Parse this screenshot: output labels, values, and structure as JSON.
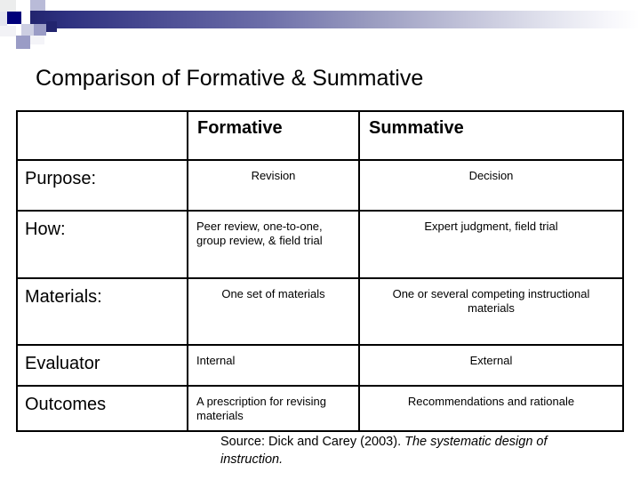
{
  "decoration": {
    "gradient_start_color": "#2e3180",
    "gradient_end_color": "#ffffff",
    "square_colors": {
      "dark": "#00007a",
      "navy": "#22246e",
      "mid": "#8f92c4",
      "light": "#b9bbd8",
      "pale": "#d8d9e9"
    }
  },
  "title": "Comparison of Formative & Summative",
  "table": {
    "headers": [
      "",
      "Formative",
      "Summative"
    ],
    "rows": [
      {
        "label": "Purpose:",
        "formative": "Revision",
        "formative_align": "center",
        "summative": "Decision",
        "summative_align": "center"
      },
      {
        "label": "How:",
        "formative": "Peer review, one-to-one, group review, & field trial",
        "formative_align": "left",
        "summative": "Expert judgment, field trial",
        "summative_align": "center"
      },
      {
        "label": "Materials:",
        "formative": "One set of materials",
        "formative_align": "center",
        "summative": "One or several competing instructional materials",
        "summative_align": "center"
      },
      {
        "label": "Evaluator",
        "formative": "Internal",
        "formative_align": "left",
        "summative": "External",
        "summative_align": "center"
      },
      {
        "label": "Outcomes",
        "formative": "A prescription for revising materials",
        "formative_align": "left",
        "summative": "Recommendations and rationale",
        "summative_align": "center"
      }
    ]
  },
  "source": {
    "prefix": "Source: Dick and Carey (2003).  ",
    "title_italic": "The systematic design of instruction."
  }
}
